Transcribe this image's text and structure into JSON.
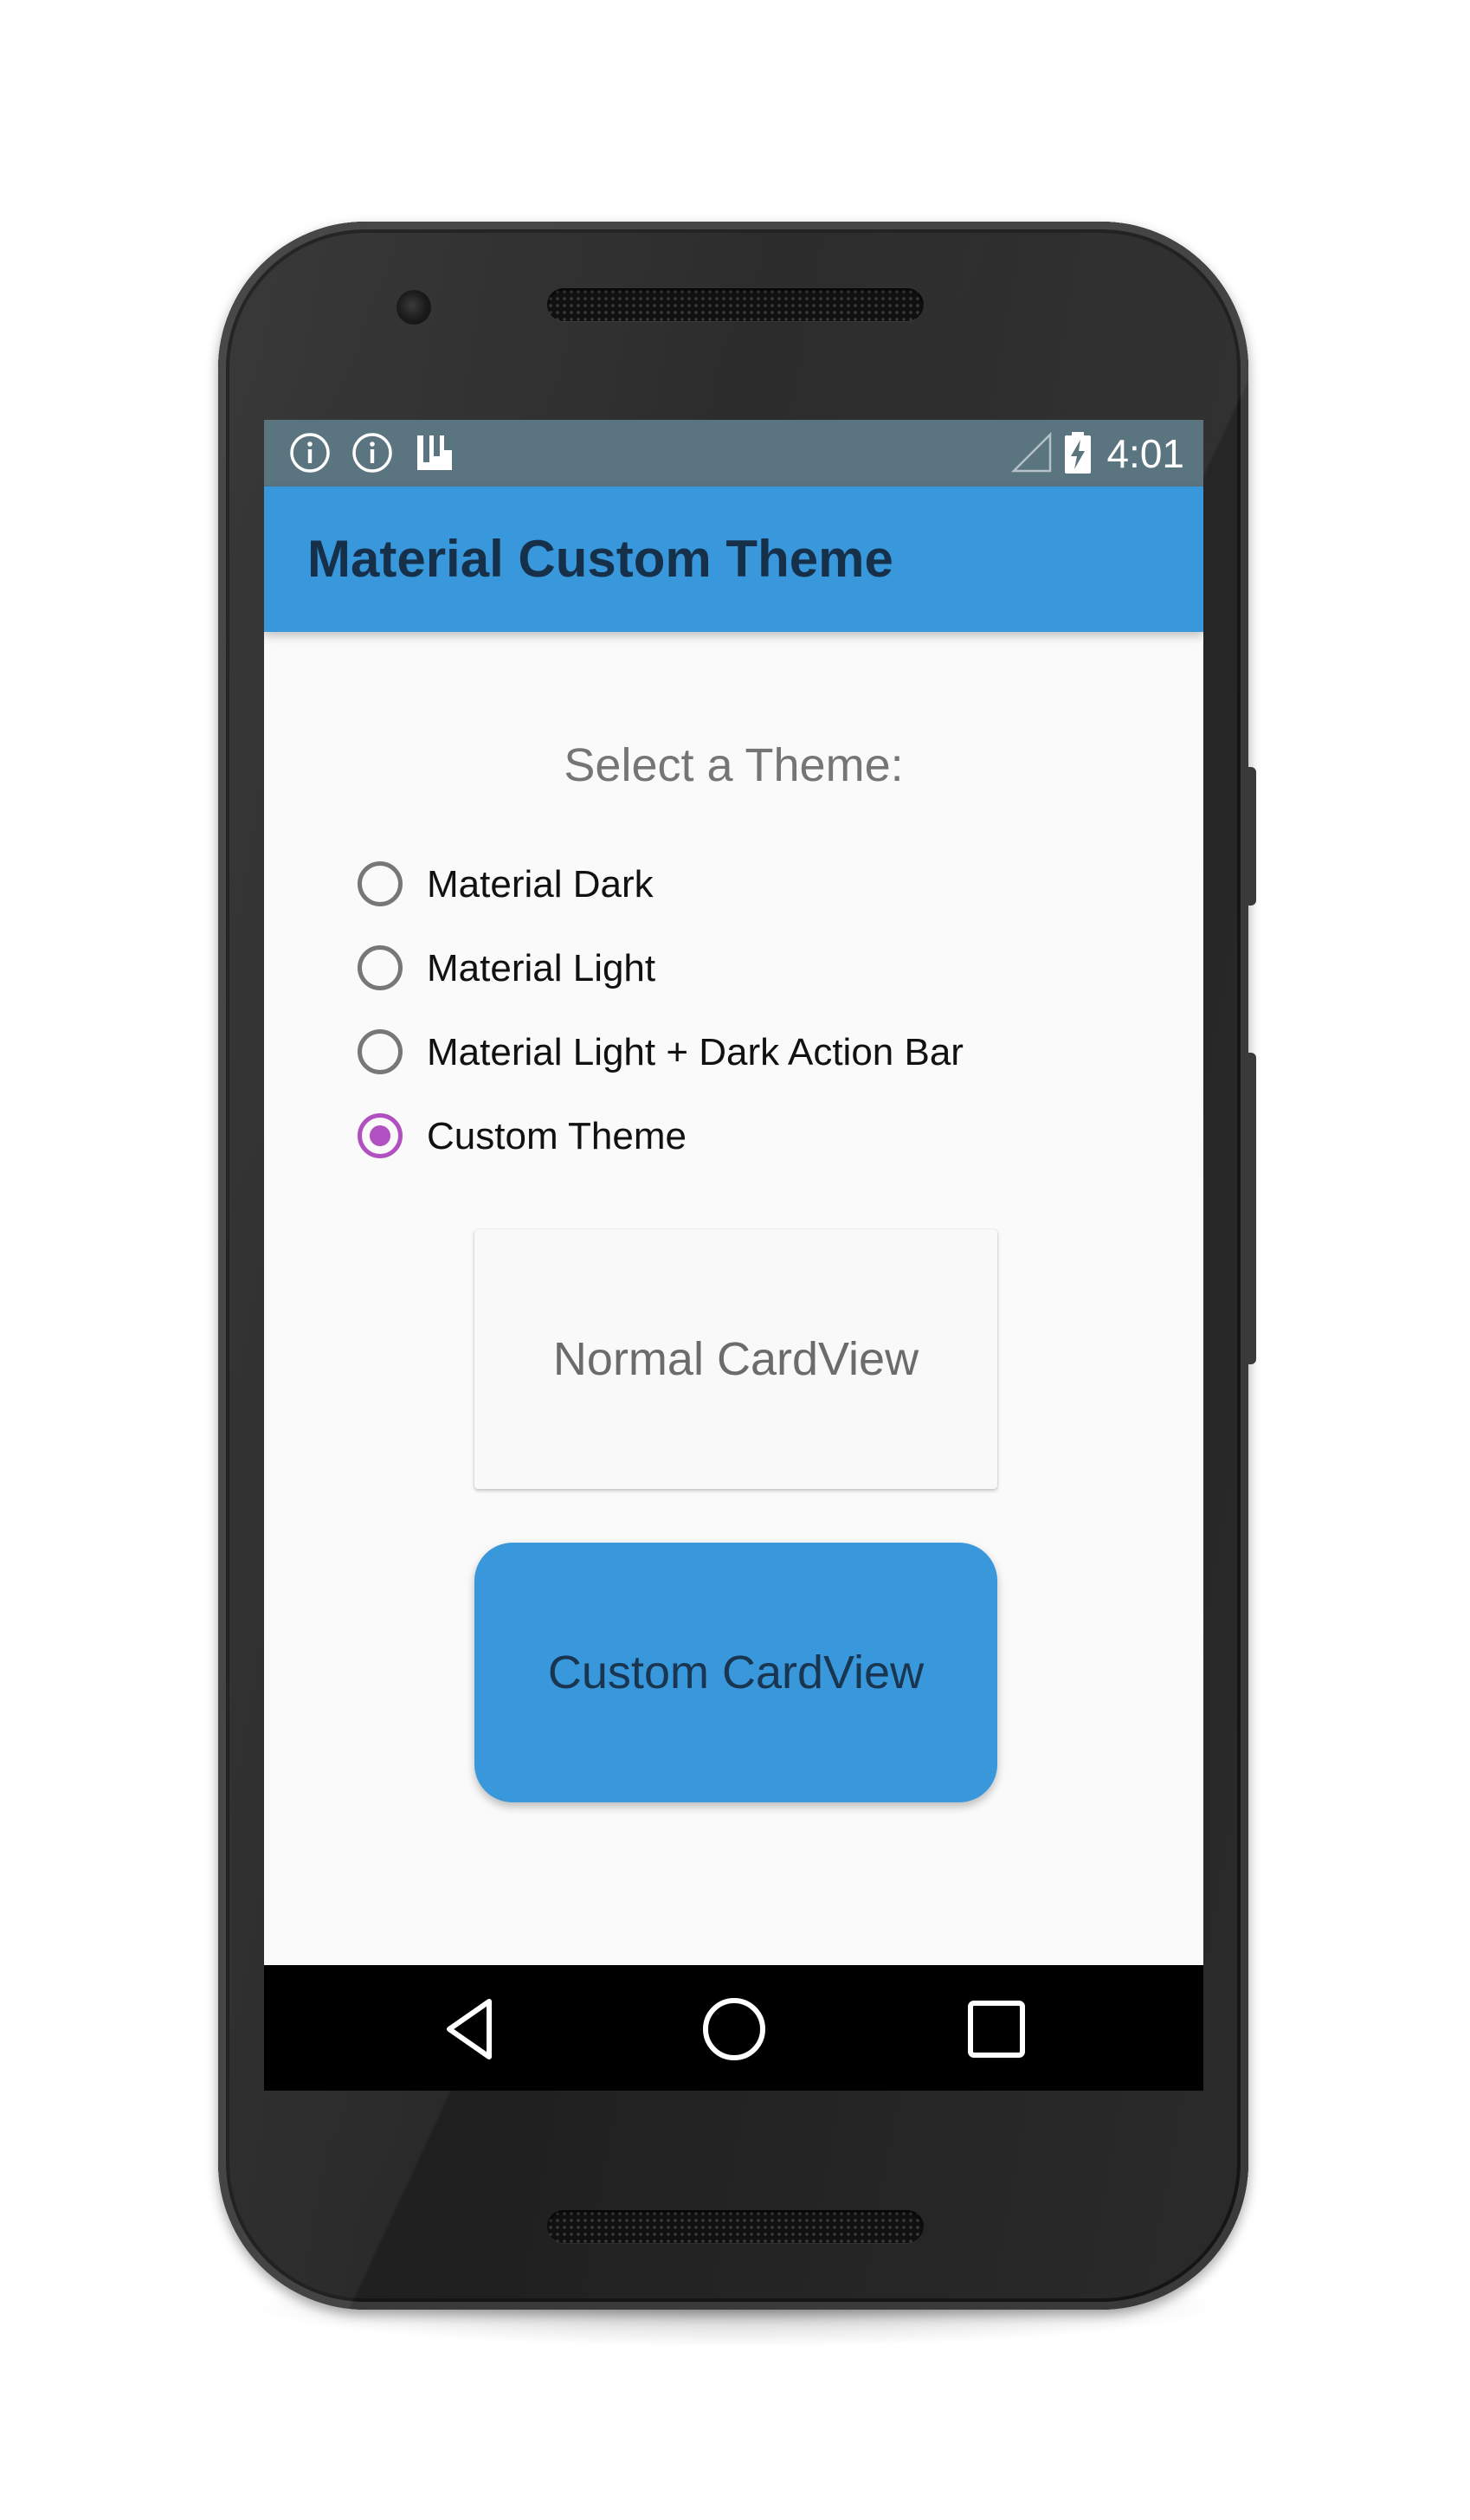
{
  "status_bar": {
    "icons": [
      "info-icon",
      "info-icon",
      "app-notification-icon",
      "signal-icon",
      "battery-charging-icon"
    ],
    "time": "4:01"
  },
  "app_bar": {
    "title": "Material Custom Theme",
    "color": "#3898db"
  },
  "main": {
    "select_label": "Select a Theme:",
    "theme_options": [
      {
        "label": "Material Dark",
        "checked": false
      },
      {
        "label": "Material Light",
        "checked": false
      },
      {
        "label": "Material Light + Dark Action Bar",
        "checked": false
      },
      {
        "label": "Custom Theme",
        "checked": true
      }
    ],
    "accent_color": "#b150c0",
    "normal_card_label": "Normal CardView",
    "custom_card_label": "Custom CardView"
  },
  "nav_bar": {
    "buttons": [
      "back-icon",
      "home-icon",
      "recents-icon"
    ]
  }
}
